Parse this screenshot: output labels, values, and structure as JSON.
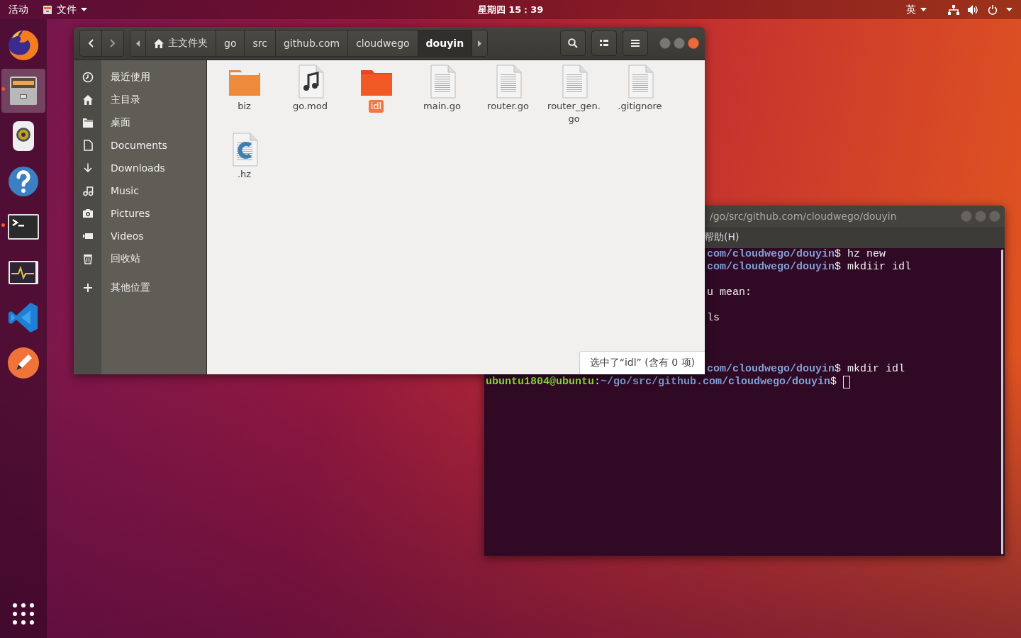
{
  "top_bar": {
    "activities": "活动",
    "app_menu": "文件",
    "clock": "星期四 15：39",
    "input_method": "英"
  },
  "dock": [
    {
      "kind": "browser",
      "selected": false,
      "running": false
    },
    {
      "kind": "files",
      "selected": true,
      "running": true
    },
    {
      "kind": "speaker",
      "selected": false,
      "running": false
    },
    {
      "kind": "help",
      "selected": false,
      "running": false
    },
    {
      "kind": "terminal",
      "selected": false,
      "running": true
    },
    {
      "kind": "monitor",
      "selected": false,
      "running": false
    },
    {
      "kind": "code",
      "selected": false,
      "running": false
    },
    {
      "kind": "pen",
      "selected": false,
      "running": false
    }
  ],
  "file_manager": {
    "breadcrumbs": [
      {
        "label": "主文件夹",
        "kind": "home",
        "selected": false
      },
      {
        "label": "go",
        "kind": "folder",
        "selected": false
      },
      {
        "label": "src",
        "kind": "folder",
        "selected": false
      },
      {
        "label": "github.com",
        "kind": "folder",
        "selected": false
      },
      {
        "label": "cloudwego",
        "kind": "folder",
        "selected": false
      },
      {
        "label": "douyin",
        "kind": "folder",
        "selected": true
      }
    ],
    "sidebar": [
      {
        "label": "最近使用",
        "kind": "recent"
      },
      {
        "label": "主目录",
        "kind": "home"
      },
      {
        "label": "桌面",
        "kind": "desktop"
      },
      {
        "label": "Documents",
        "kind": "document"
      },
      {
        "label": "Downloads",
        "kind": "download"
      },
      {
        "label": "Music",
        "kind": "music"
      },
      {
        "label": "Pictures",
        "kind": "picture"
      },
      {
        "label": "Videos",
        "kind": "video"
      },
      {
        "label": "回收站",
        "kind": "trash"
      },
      {
        "label": "其他位置",
        "kind": "plus"
      }
    ],
    "files": [
      {
        "name": "biz",
        "kind": "folder",
        "selected": false
      },
      {
        "name": "go.mod",
        "kind": "audio",
        "selected": false
      },
      {
        "name": "idl",
        "kind": "folder",
        "selected": true
      },
      {
        "name": "main.go",
        "kind": "text",
        "selected": false
      },
      {
        "name": "router.go",
        "kind": "text",
        "selected": false
      },
      {
        "name": "router_gen.go",
        "kind": "text",
        "selected": false
      },
      {
        "name": ".gitignore",
        "kind": "text",
        "selected": false
      },
      {
        "name": ".hz",
        "kind": "source",
        "selected": false
      }
    ],
    "status": "选中了“idl” (含有 0 项)"
  },
  "terminal": {
    "title": "/go/src/github.com/cloudwego/douyin",
    "menu": [
      "帮助(H)"
    ],
    "lines": [
      {
        "kind": "text",
        "segments": [
          {
            "kind": "path",
            "text": "com/cloudwego/douyin"
          },
          {
            "kind": "plain",
            "text": "$ hz new"
          }
        ]
      },
      {
        "kind": "text",
        "segments": [
          {
            "kind": "path",
            "text": "com/cloudwego/douyin"
          },
          {
            "kind": "plain",
            "text": "$ mkdiir idl"
          }
        ]
      },
      {
        "kind": "blank"
      },
      {
        "kind": "text",
        "segments": [
          {
            "kind": "plain",
            "text": "u mean:"
          }
        ]
      },
      {
        "kind": "blank"
      },
      {
        "kind": "text",
        "segments": [
          {
            "kind": "plain",
            "text": "ls"
          }
        ]
      },
      {
        "kind": "blank"
      },
      {
        "kind": "blank"
      },
      {
        "kind": "blank"
      },
      {
        "kind": "text",
        "segments": [
          {
            "kind": "path",
            "text": "com/cloudwego/douyin"
          },
          {
            "kind": "plain",
            "text": "$ mkdir idl"
          }
        ]
      },
      {
        "kind": "full",
        "segments": [
          {
            "kind": "user",
            "text": "ubuntu1804@ubuntu"
          },
          {
            "kind": "plain",
            "text": ":"
          },
          {
            "kind": "path",
            "text": "~/go/src/github.com/cloudwego/douyin"
          },
          {
            "kind": "plain",
            "text": "$ "
          }
        ],
        "cursor": true
      }
    ]
  }
}
